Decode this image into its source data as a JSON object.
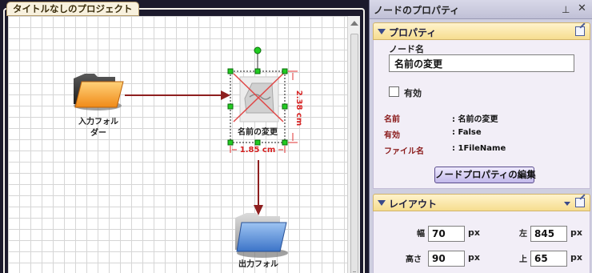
{
  "project": {
    "tab_title": "タイトルなしのプロジェクト"
  },
  "canvas": {
    "input_folder_label_line1": "入力フォル",
    "input_folder_label_line2": "ダー",
    "rename_node_label": "名前の変更",
    "width_dimension": "1.85 cm",
    "height_dimension": "2.38 cm",
    "output_folder_label": "出力フォル"
  },
  "properties": {
    "title": "ノードのプロパティ",
    "pin_icon": "pin-icon",
    "close_icon": "close-icon",
    "property_section": {
      "header": "プロパティ",
      "node_name_label": "ノード名",
      "node_name_value": "名前の変更",
      "enabled_label": "有効",
      "enabled_checked": false,
      "rows": [
        {
          "key": "名前",
          "value": ": 名前の変更"
        },
        {
          "key": "有効",
          "value": ": False"
        },
        {
          "key": "ファイル名",
          "value": ": 1FileName"
        }
      ],
      "edit_button": "ノードプロパティの編集"
    },
    "layout_section": {
      "header": "レイアウト",
      "width_label": "幅",
      "width_value": "70",
      "height_label": "高さ",
      "height_value": "90",
      "left_label": "左",
      "left_value": "845",
      "top_label": "上",
      "top_value": "65",
      "unit": "px"
    }
  },
  "colors": {
    "accent_arrow": "#8e1f1f",
    "selection_handle": "#22cc22",
    "dimension": "#e03030",
    "section_header": "#f6dd8f"
  }
}
